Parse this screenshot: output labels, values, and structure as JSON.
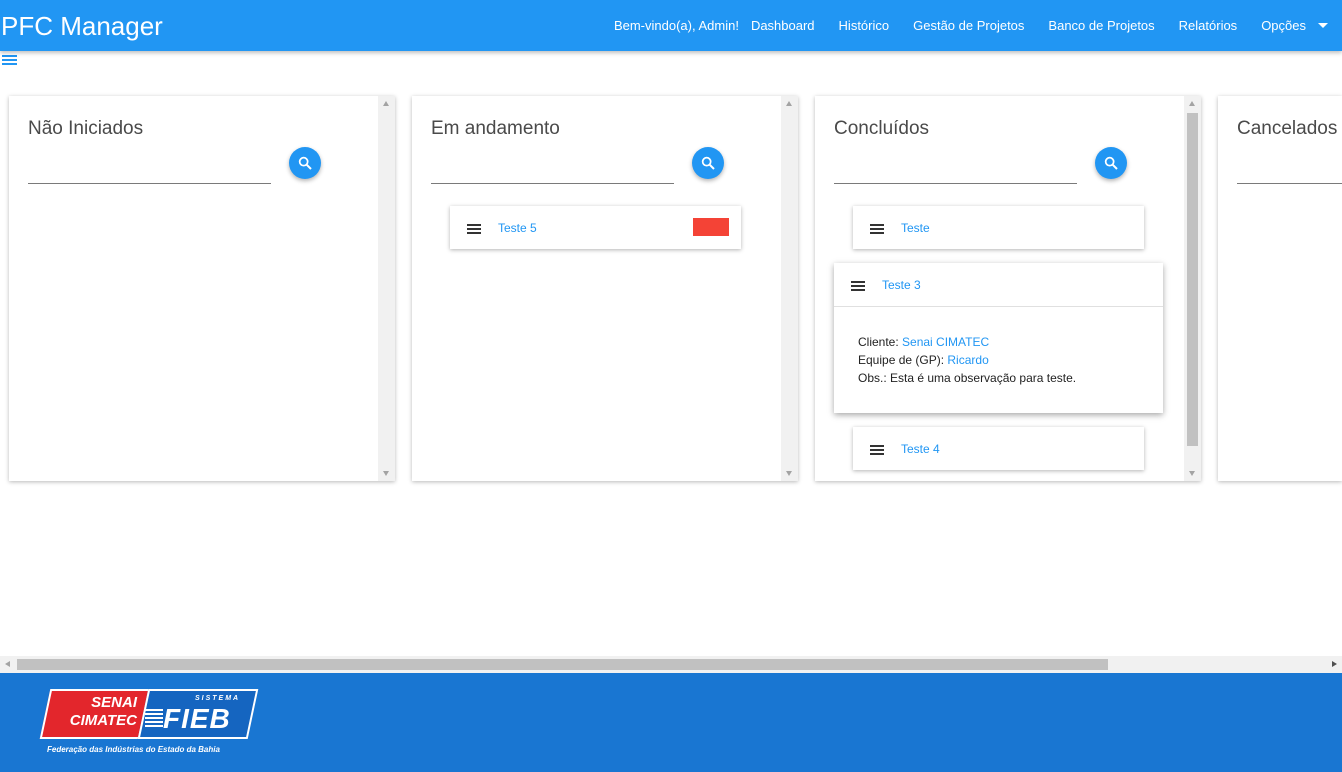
{
  "header": {
    "brand": "PFC Manager",
    "welcome": "Bem-vindo(a), Admin!",
    "nav": {
      "dashboard": "Dashboard",
      "historico": "Histórico",
      "gestao": "Gestão de Projetos",
      "banco": "Banco de Projetos",
      "relatorios": "Relatórios",
      "opcoes": "Opções"
    }
  },
  "columns": {
    "nao_iniciados": {
      "title": "Não Iniciados",
      "search_value": ""
    },
    "em_andamento": {
      "title": "Em andamento",
      "search_value": "",
      "cards": [
        {
          "title": "Teste 5",
          "status_color": "#f44336"
        }
      ]
    },
    "concluidos": {
      "title": "Concluídos",
      "search_value": "",
      "cards": [
        {
          "title": "Teste"
        },
        {
          "title": "Teste 3",
          "cliente_label": "Cliente:",
          "cliente_value": "Senai CIMATEC",
          "equipe_label": "Equipe de (GP):",
          "equipe_value": "Ricardo",
          "obs": "Obs.: Esta é uma observação para teste."
        },
        {
          "title": "Teste 4"
        }
      ]
    },
    "cancelados": {
      "title": "Cancelados",
      "search_value": ""
    }
  },
  "footer": {
    "logo_senai": "SENAI",
    "logo_cimatec": "CIMATEC",
    "logo_sistema": "SISTEMA",
    "logo_fieb": "FIEB",
    "logo_tagline": "Federação das Indústrias do Estado da Bahia"
  },
  "colors": {
    "primary": "#2196f3",
    "footer": "#1976d2",
    "status_red": "#f44336"
  }
}
